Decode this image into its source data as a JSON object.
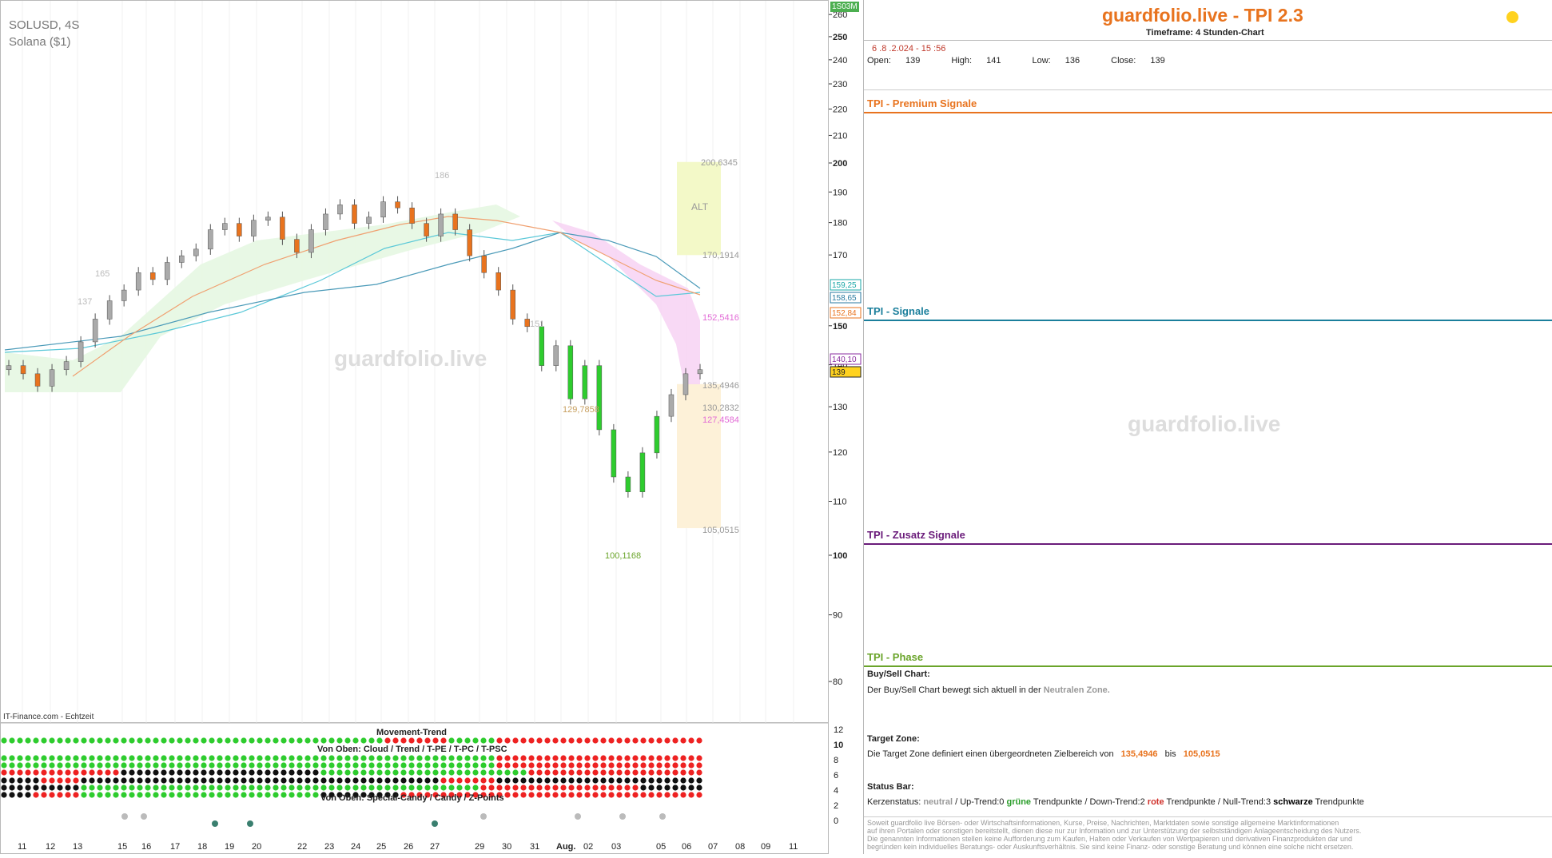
{
  "symbol": "SOLUSD, 4S",
  "name": "Solana ($1)",
  "watermark": "guardfolio.live",
  "source": "IT-Finance.com - Echtzeit",
  "timeframe_badge": "1S03M",
  "colors": {
    "orange": "#e8731e",
    "teal": "#1b7f9c",
    "purple": "#6a1b7a",
    "green": "#6aa42a",
    "up": "#2ecc2e",
    "down": "#e34",
    "neutral": "#999"
  },
  "chart_data": {
    "type": "candlestick",
    "y_axis_ticks": [
      260,
      250,
      240,
      230,
      220,
      210,
      200,
      190,
      180,
      170,
      150,
      140,
      130,
      120,
      110,
      100,
      90,
      80
    ],
    "log_scale": true,
    "x_ticks": [
      "11",
      "12",
      "13",
      "15",
      "16",
      "17",
      "18",
      "19",
      "20",
      "22",
      "23",
      "24",
      "25",
      "26",
      "27",
      "29",
      "30",
      "31",
      "Aug.",
      "02",
      "03",
      "05",
      "06",
      "07",
      "08",
      "09",
      "11"
    ],
    "price_labels": [
      {
        "text": "159,25",
        "color": "#1aa7a7"
      },
      {
        "text": "158,65",
        "color": "#2a7aa0"
      },
      {
        "text": "152,84",
        "color": "#e8731e"
      },
      {
        "text": "140,10",
        "color": "#8b2da0"
      },
      {
        "text": "139",
        "color": "#222"
      }
    ],
    "annotations": [
      "200,6345",
      "ALT",
      "170,1914",
      "152,5416",
      "135,4946",
      "130,2832",
      "127,4584",
      "105,0515",
      "100,1168",
      "129,7858",
      "186",
      "165",
      "137",
      "151"
    ],
    "target_zone": [
      135.4946,
      105.0515
    ],
    "alt_zone": [
      200.6345,
      170.1914
    ]
  },
  "indicator": {
    "title": "Movement-Trend",
    "subtitle_top": "Von Oben: Cloud / Trend / T-PE / T-PC / T-PSC",
    "subtitle_bottom": "Von Oben: Special-Candy / Candy / Z-Points",
    "y_ticks": [
      "12",
      "10",
      "8",
      "6",
      "4",
      "2",
      "0"
    ]
  },
  "panel": {
    "title": "guardfolio.live - TPI 2.3",
    "timeframe": "Timeframe: 4 Stunden-Chart",
    "datetime": "6 .8 .2.024 - 15 :56",
    "ohlc": {
      "open_label": "Open:",
      "open": "139",
      "high_label": "High:",
      "high": "141",
      "low_label": "Low:",
      "low": "136",
      "close_label": "Close:",
      "close": "139"
    },
    "sections": {
      "premium": "TPI - Premium Signale",
      "signale": "TPI - Signale",
      "zusatz": "TPI - Zusatz Signale",
      "phase": "TPI - Phase"
    },
    "buysell_title": "Buy/Sell Chart:",
    "buysell_text": "Der Buy/Sell Chart bewegt sich aktuell in der",
    "buysell_zone": "Neutralen Zone.",
    "target_title": "Target Zone:",
    "target_text": "Die Target Zone definiert einen übergeordneten Zielbereich von",
    "target_from": "135,4946",
    "target_bis": "bis",
    "target_to": "105,0515",
    "status_title": "Status Bar:",
    "status_k": "Kerzenstatus:",
    "status_neutral": "neutral",
    "status_up": "/ Up-Trend:0",
    "status_green": "grüne",
    "status_tp1": "Trendpunkte",
    "status_down": "/ Down-Trend:2",
    "status_red": "rote",
    "status_tp2": "Trendpunkte",
    "status_null": "/ Null-Trend:3",
    "status_black": "schwarze",
    "status_tp3": "Trendpunkte",
    "disclaimer": [
      "Soweit guardfolio live Börsen- oder Wirtschaftsinformationen, Kurse, Preise, Nachrichten, Marktdaten sowie sonstige allgemeine Marktinformationen",
      "auf ihren Portalen oder sonstigen bereitstellt, dienen diese nur zur Information und zur Unterstützung der selbstständigen Anlageentscheidung des Nutzers.",
      "Die genannten Informationen stellen keine Aufforderung zum Kaufen, Halten oder Verkaufen von Wertpapieren und derivativen Finanzprodukten dar und",
      "begründen kein individuelles Beratungs- oder Auskunftsverhältnis. Sie sind keine Finanz- oder sonstige Beratung und können eine solche nicht ersetzen."
    ]
  }
}
